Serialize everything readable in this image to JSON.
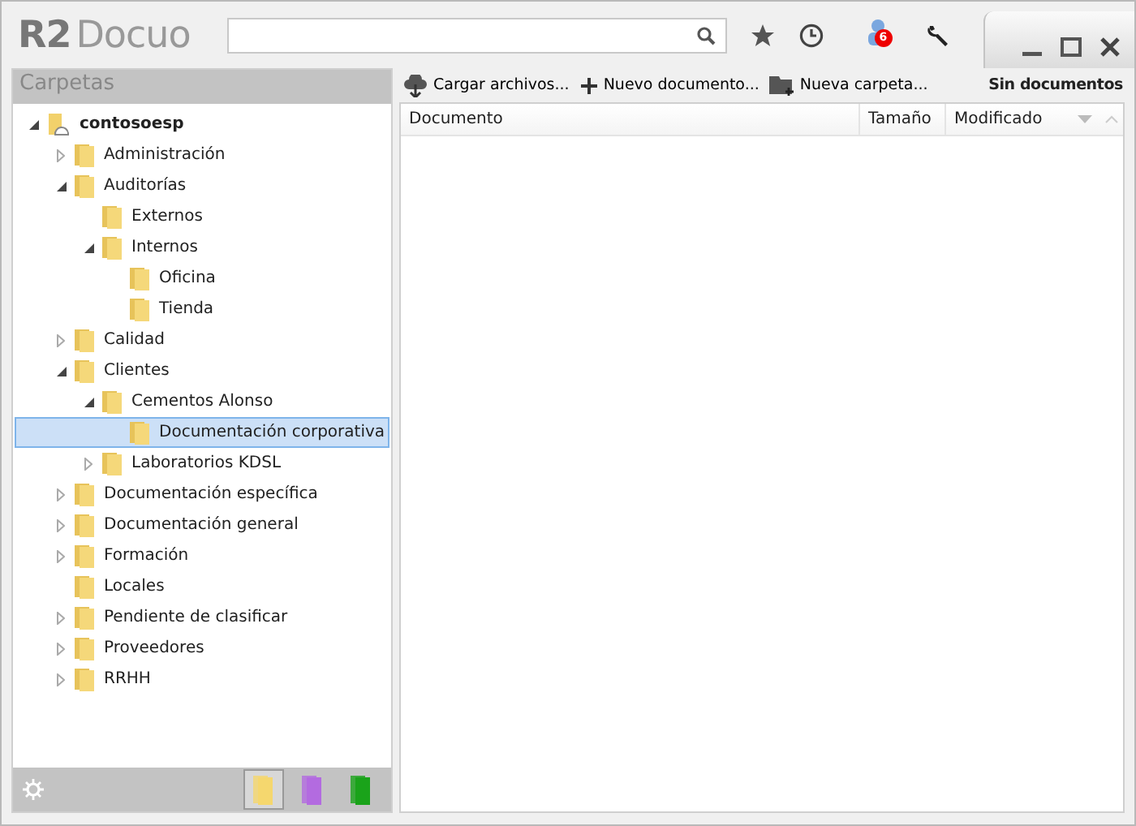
{
  "app": {
    "logo_mark": "R2",
    "logo_text": "Docuo",
    "notifications_badge": "6"
  },
  "sidebar": {
    "title": "Carpetas",
    "tree": [
      {
        "label": "contosoesp",
        "kind": "root",
        "expanded": true,
        "selected": false,
        "children": [
          {
            "label": "Administración",
            "expanded": false,
            "selected": false
          },
          {
            "label": "Auditorías",
            "expanded": true,
            "selected": false,
            "children": [
              {
                "label": "Externos",
                "selected": false
              },
              {
                "label": "Internos",
                "expanded": true,
                "selected": false,
                "children": [
                  {
                    "label": "Oficina",
                    "selected": false
                  },
                  {
                    "label": "Tienda",
                    "selected": false
                  }
                ]
              }
            ]
          },
          {
            "label": "Calidad",
            "expanded": false,
            "selected": false
          },
          {
            "label": "Clientes",
            "expanded": true,
            "selected": false,
            "children": [
              {
                "label": "Cementos Alonso",
                "expanded": true,
                "selected": false,
                "children": [
                  {
                    "label": "Documentación corporativa",
                    "selected": true
                  }
                ]
              },
              {
                "label": "Laboratorios KDSL",
                "expanded": false,
                "selected": false
              }
            ]
          },
          {
            "label": "Documentación específica",
            "expanded": false,
            "selected": false
          },
          {
            "label": "Documentación general",
            "expanded": false,
            "selected": false
          },
          {
            "label": "Formación",
            "expanded": false,
            "selected": false
          },
          {
            "label": "Locales",
            "selected": false
          },
          {
            "label": "Pendiente de clasificar",
            "expanded": false,
            "selected": false
          },
          {
            "label": "Proveedores",
            "expanded": false,
            "selected": false
          },
          {
            "label": "RRHH",
            "expanded": false,
            "selected": false
          }
        ]
      }
    ],
    "folder_views": [
      {
        "color": "#f5d76e",
        "selected": true
      },
      {
        "color": "#b36be0",
        "selected": false
      },
      {
        "color": "#1aa31a",
        "selected": false
      }
    ]
  },
  "toolbar": {
    "actions": [
      {
        "label": "Cargar archivos...",
        "kind": "upload"
      },
      {
        "label": "Nuevo documento...",
        "kind": "new"
      },
      {
        "label": "Nueva carpeta...",
        "kind": "folder"
      }
    ],
    "status": "Sin documentos"
  },
  "table": {
    "columns": [
      "Documento",
      "Tamaño",
      "Modificado"
    ]
  }
}
